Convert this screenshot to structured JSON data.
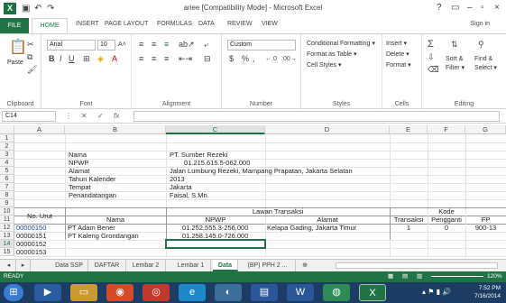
{
  "window": {
    "title": "ariee [Compatibility Mode] - Microsoft Excel",
    "signin": "Sign in",
    "help": "?"
  },
  "ribbon_tabs": [
    "FILE",
    "HOME",
    "INSERT",
    "PAGE LAYOUT",
    "FORMULAS",
    "DATA",
    "REVIEW",
    "VIEW"
  ],
  "ribbon": {
    "paste": "Paste",
    "font_name": "Arial",
    "font_size": "10",
    "number_format": "Custom",
    "groups": [
      "Clipboard",
      "Font",
      "Alignment",
      "Number",
      "Styles",
      "Cells",
      "Editing"
    ],
    "styles": [
      "Conditional Formatting ▾",
      "Format as Table ▾",
      "Cell Styles ▾"
    ],
    "cells": [
      "Insert ▾",
      "Delete ▾",
      "Format ▾"
    ],
    "editing": [
      "Sort &",
      "Filter ▾",
      "Find &",
      "Select ▾"
    ]
  },
  "formula_bar": {
    "name_box": "C14",
    "fx": "fx"
  },
  "columns": [
    "A",
    "B",
    "C",
    "D",
    "E",
    "F",
    "G"
  ],
  "rows": [
    "1",
    "2",
    "3",
    "4",
    "5",
    "6",
    "7",
    "8",
    "9",
    "10",
    "11",
    "12",
    "13",
    "14",
    "15"
  ],
  "cells": {
    "b3": "Nama",
    "c3": "PT. Sumber Rezeki",
    "b4": "NPWP",
    "c4": "01.215.615.5-062.000",
    "b5": "Alamat",
    "c5": "Jalan Lumbung Rezeki, Mampang Prapatan, Jakarta Selatan",
    "b6": "Tahun Kalender",
    "c6": "2013",
    "b7": "Tempat",
    "c7": "Jakarta",
    "b8": "Penandatangan",
    "c8": "Faisal, S.Mn.",
    "a10": "No. Urut",
    "c10": "Lawan Transaksi",
    "f10": "Kode",
    "b11": "Nama",
    "c11": "NPWP",
    "d11": "Alamat",
    "e11": "Transaksi",
    "f11": "Pengganti",
    "g11": "FP",
    "a12": "00000150",
    "b12": "PT Adam Bener",
    "c12": "01.252.555.3-256.000",
    "d12": "Kelapa Gading, Jakarta Timur",
    "e12": "1",
    "f12": "0",
    "g12": "900-13",
    "a13": "00000151",
    "b13": "PT Kaleng Grondangan",
    "c13": "01.258.145.0-726.000",
    "a14": "00000152",
    "a15": "00000153"
  },
  "sheet_tabs": [
    "Data SSP",
    "DAFTAR",
    "Lembar 2",
    "Lembar 1",
    "Data",
    "(BP) PPH 2 ..."
  ],
  "active_sheet": "Data",
  "status": {
    "ready": "READY",
    "zoom": "120%"
  },
  "clock": {
    "time": "7:52 PM",
    "date": "7/16/2014"
  },
  "colors": {
    "excel_green": "#217346",
    "taskbar": "#1d3c63",
    "link_blue": "#1f3fbf"
  }
}
